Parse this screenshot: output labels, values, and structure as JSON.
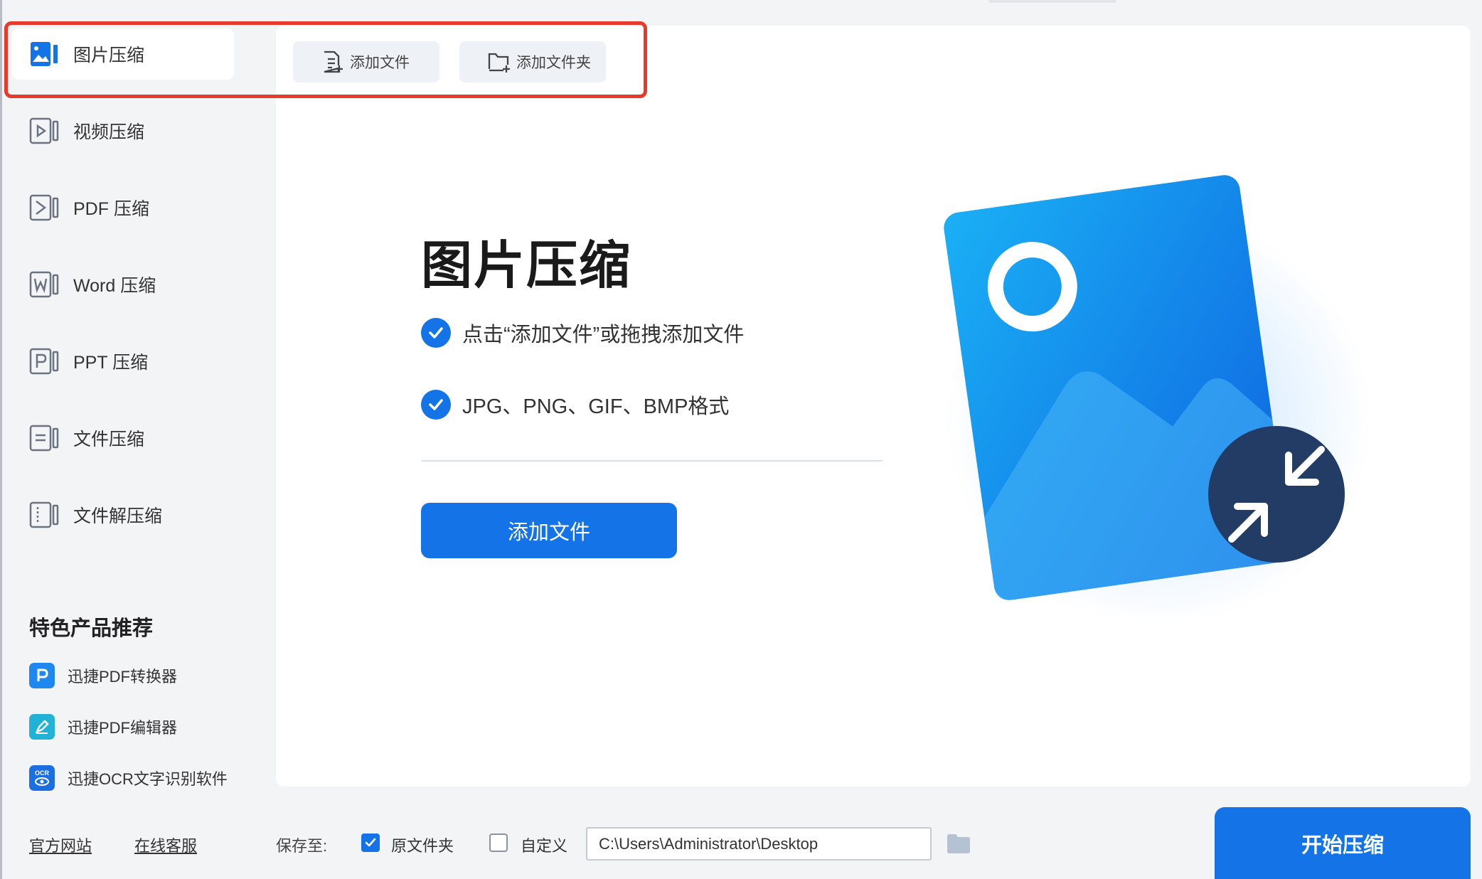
{
  "sidebar": {
    "items": [
      {
        "label": "图片压缩",
        "icon": "image-compress-icon",
        "active": true
      },
      {
        "label": "视频压缩",
        "icon": "video-compress-icon"
      },
      {
        "label": "PDF 压缩",
        "icon": "pdf-compress-icon"
      },
      {
        "label": "Word 压缩",
        "icon": "word-compress-icon"
      },
      {
        "label": "PPT 压缩",
        "icon": "ppt-compress-icon"
      },
      {
        "label": "文件压缩",
        "icon": "file-compress-icon"
      },
      {
        "label": "文件解压缩",
        "icon": "file-decompress-icon"
      }
    ],
    "promo_title": "特色产品推荐",
    "promos": [
      {
        "label": "迅捷PDF转换器",
        "icon": "pdf-converter-icon"
      },
      {
        "label": "迅捷PDF编辑器",
        "icon": "pdf-editor-icon"
      },
      {
        "label": "迅捷OCR文字识别软件",
        "icon": "ocr-icon",
        "icon_text": "OCR"
      }
    ],
    "links": {
      "website": "官方网站",
      "support": "在线客服"
    }
  },
  "toolbar": {
    "add_file": "添加文件",
    "add_folder": "添加文件夹"
  },
  "main": {
    "heading": "图片压缩",
    "bullets": [
      "点击“添加文件”或拖拽添加文件",
      "JPG、PNG、GIF、BMP格式"
    ],
    "add_button": "添加文件"
  },
  "bottom": {
    "save_to_label": "保存至:",
    "original_folder": {
      "label": "原文件夹",
      "checked": true
    },
    "custom": {
      "label": "自定义",
      "checked": false
    },
    "path": "C:\\Users\\Administrator\\Desktop",
    "start_button": "开始压缩"
  },
  "colors": {
    "accent": "#1473e6",
    "highlight": "#e53a2c",
    "navy": "#233c66"
  }
}
